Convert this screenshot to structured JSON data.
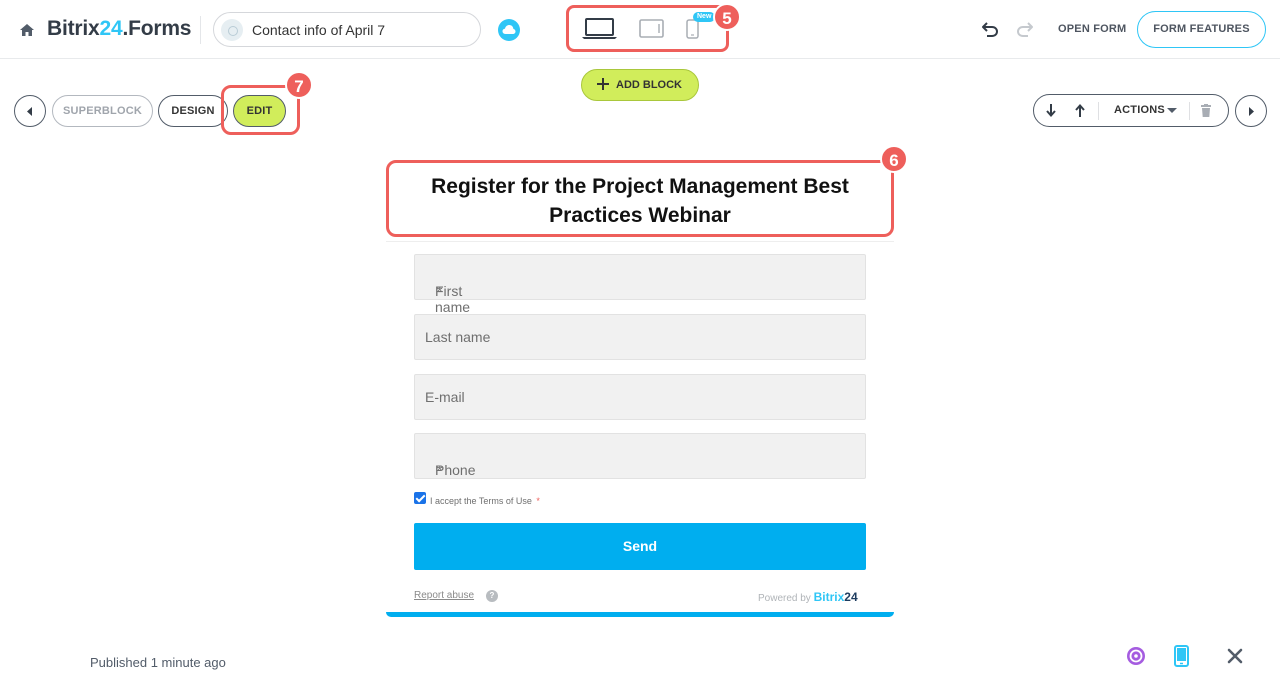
{
  "header": {
    "brand_main": "Bitrix",
    "brand_accent": "24",
    "brand_tail": ".Forms",
    "form_name": "Contact info of April 7",
    "new_badge": "New",
    "open_form": "OPEN FORM",
    "form_features": "FORM FEATURES",
    "accent_color": "#2fc6f6"
  },
  "markers": {
    "devices": "5",
    "title": "6",
    "edit": "7",
    "marker_color": "#ee5f5b"
  },
  "toolbar": {
    "superblock": "SUPERBLOCK",
    "design": "DESIGN",
    "edit": "EDIT",
    "add_block": "ADD BLOCK",
    "actions": "ACTIONS"
  },
  "form": {
    "title": "Register for the Project Management Best Practices Webinar",
    "fields": [
      {
        "label": "First name",
        "required": "*"
      },
      {
        "label": "Last name",
        "required": ""
      },
      {
        "label": "E-mail",
        "required": ""
      },
      {
        "label": "Phone",
        "required": "*"
      }
    ],
    "terms": "I accept the Terms of Use",
    "terms_required": "*",
    "send": "Send",
    "report_abuse": "Report abuse",
    "help": "?",
    "powered_by": "Powered by",
    "powered_brand": "Bitrix",
    "powered_num": "24",
    "button_color": "#00aeef"
  },
  "footer": {
    "published": "Published 1 minute ago"
  },
  "icons": [
    "home-icon",
    "cloud-icon",
    "laptop-icon",
    "tablet-icon",
    "phone-icon",
    "undo-icon",
    "redo-icon",
    "arrow-left-icon",
    "arrow-right-icon",
    "arrow-down-icon",
    "arrow-up-icon",
    "trash-icon",
    "ai-assistant-icon",
    "mobile-preview-icon",
    "close-icon"
  ]
}
